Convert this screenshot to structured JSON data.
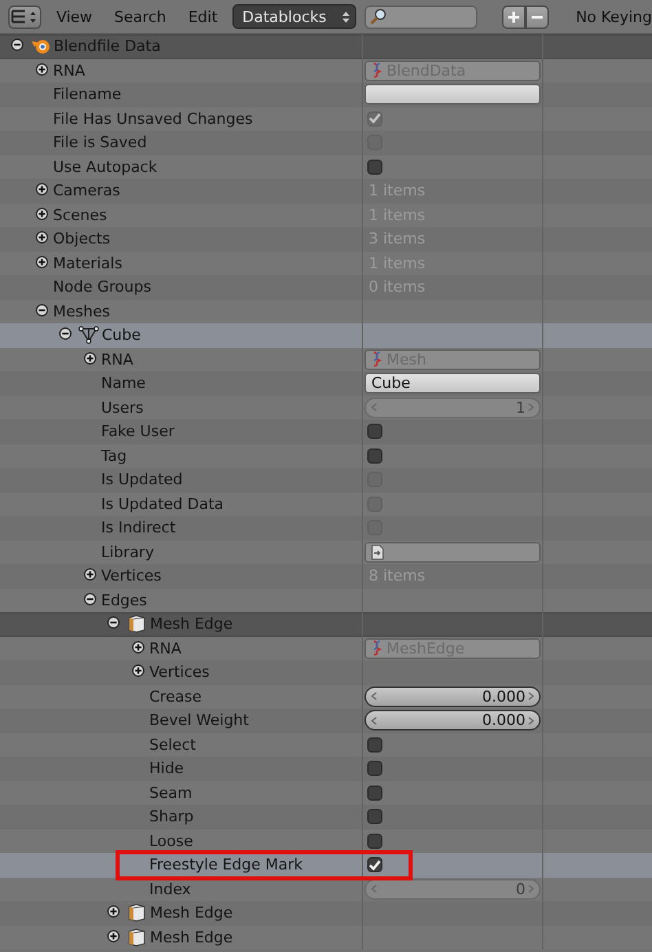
{
  "header": {
    "menus": [
      "View",
      "Search",
      "Edit"
    ],
    "display_mode": "Datablocks",
    "keying": "No Keying"
  },
  "tree": [
    {
      "label": "Blendfile Data",
      "kind": "blend",
      "expanded": true,
      "selected": false,
      "active": true,
      "children": [
        {
          "label": "RNA",
          "expanded": false,
          "selected": false,
          "active": false,
          "value": {
            "kind": "rna",
            "text": "BlendData"
          }
        },
        {
          "label": "Filename",
          "selected": false,
          "active": false,
          "value": {
            "kind": "field"
          }
        },
        {
          "label": "File Has Unsaved Changes",
          "selected": false,
          "active": false,
          "value": {
            "kind": "checkbox",
            "checked": true,
            "disabled": true
          }
        },
        {
          "label": "File is Saved",
          "selected": false,
          "active": false,
          "value": {
            "kind": "checkbox",
            "checked": false,
            "disabled": true
          }
        },
        {
          "label": "Use Autopack",
          "selected": false,
          "active": false,
          "value": {
            "kind": "checkbox",
            "checked": false,
            "disabled": false
          }
        },
        {
          "label": "Cameras",
          "expanded": false,
          "selected": false,
          "active": false,
          "value": {
            "kind": "count",
            "text": "1 items"
          }
        },
        {
          "label": "Scenes",
          "expanded": false,
          "selected": false,
          "active": false,
          "value": {
            "kind": "count",
            "text": "1 items"
          }
        },
        {
          "label": "Objects",
          "expanded": false,
          "selected": false,
          "active": false,
          "value": {
            "kind": "count",
            "text": "3 items"
          }
        },
        {
          "label": "Materials",
          "expanded": false,
          "selected": false,
          "active": false,
          "value": {
            "kind": "count",
            "text": "1 items"
          }
        },
        {
          "label": "Node Groups",
          "selected": false,
          "active": false,
          "value": {
            "kind": "count",
            "text": "0 items"
          }
        },
        {
          "label": "Meshes",
          "expanded": true,
          "selected": false,
          "active": false,
          "children": [
            {
              "label": "Cube",
              "kind": "mesh",
              "expanded": true,
              "selected": true,
              "active": false,
              "children": [
                {
                  "label": "RNA",
                  "expanded": false,
                  "selected": false,
                  "active": false,
                  "value": {
                    "kind": "rna",
                    "text": "Mesh"
                  }
                },
                {
                  "label": "Name",
                  "selected": false,
                  "active": false,
                  "value": {
                    "kind": "field",
                    "text": "Cube"
                  }
                },
                {
                  "label": "Users",
                  "selected": false,
                  "active": false,
                  "value": {
                    "kind": "number",
                    "text": "1",
                    "disabled": true
                  }
                },
                {
                  "label": "Fake User",
                  "selected": false,
                  "active": false,
                  "value": {
                    "kind": "checkbox",
                    "checked": false,
                    "disabled": false
                  }
                },
                {
                  "label": "Tag",
                  "selected": false,
                  "active": false,
                  "value": {
                    "kind": "checkbox",
                    "checked": false,
                    "disabled": false
                  }
                },
                {
                  "label": "Is Updated",
                  "selected": false,
                  "active": false,
                  "value": {
                    "kind": "checkbox",
                    "checked": false,
                    "disabled": true
                  }
                },
                {
                  "label": "Is Updated Data",
                  "selected": false,
                  "active": false,
                  "value": {
                    "kind": "checkbox",
                    "checked": false,
                    "disabled": true
                  }
                },
                {
                  "label": "Is Indirect",
                  "selected": false,
                  "active": false,
                  "value": {
                    "kind": "checkbox",
                    "checked": false,
                    "disabled": true
                  }
                },
                {
                  "label": "Library",
                  "selected": false,
                  "active": false,
                  "value": {
                    "kind": "library"
                  }
                },
                {
                  "label": "Vertices",
                  "expanded": false,
                  "selected": false,
                  "active": false,
                  "value": {
                    "kind": "count",
                    "text": "8 items"
                  }
                },
                {
                  "label": "Edges",
                  "expanded": true,
                  "selected": false,
                  "active": false,
                  "children": [
                    {
                      "label": "Mesh Edge",
                      "kind": "edge",
                      "expanded": true,
                      "selected": false,
                      "active": true,
                      "children": [
                        {
                          "label": "RNA",
                          "expanded": false,
                          "selected": false,
                          "active": false,
                          "value": {
                            "kind": "rna",
                            "text": "MeshEdge"
                          }
                        },
                        {
                          "label": "Vertices",
                          "expanded": false,
                          "selected": false,
                          "active": false
                        },
                        {
                          "label": "Crease",
                          "selected": false,
                          "active": false,
                          "value": {
                            "kind": "number",
                            "text": "0.000",
                            "disabled": false
                          }
                        },
                        {
                          "label": "Bevel Weight",
                          "selected": false,
                          "active": false,
                          "value": {
                            "kind": "number",
                            "text": "0.000",
                            "disabled": false
                          }
                        },
                        {
                          "label": "Select",
                          "selected": false,
                          "active": false,
                          "value": {
                            "kind": "checkbox",
                            "checked": false,
                            "disabled": false
                          }
                        },
                        {
                          "label": "Hide",
                          "selected": false,
                          "active": false,
                          "value": {
                            "kind": "checkbox",
                            "checked": false,
                            "disabled": false
                          }
                        },
                        {
                          "label": "Seam",
                          "selected": false,
                          "active": false,
                          "value": {
                            "kind": "checkbox",
                            "checked": false,
                            "disabled": false
                          }
                        },
                        {
                          "label": "Sharp",
                          "selected": false,
                          "active": false,
                          "value": {
                            "kind": "checkbox",
                            "checked": false,
                            "disabled": false
                          }
                        },
                        {
                          "label": "Loose",
                          "selected": false,
                          "active": false,
                          "value": {
                            "kind": "checkbox",
                            "checked": false,
                            "disabled": false
                          }
                        },
                        {
                          "label": "Freestyle Edge Mark",
                          "selected": true,
                          "active": false,
                          "boxed": true,
                          "value": {
                            "kind": "checkbox",
                            "checked": true,
                            "disabled": false
                          }
                        },
                        {
                          "label": "Index",
                          "selected": false,
                          "active": false,
                          "value": {
                            "kind": "number",
                            "text": "0",
                            "disabled": true
                          }
                        }
                      ]
                    },
                    {
                      "label": "Mesh Edge",
                      "kind": "edge",
                      "expanded": false,
                      "selected": false,
                      "active": false
                    },
                    {
                      "label": "Mesh Edge",
                      "kind": "edge",
                      "expanded": false,
                      "selected": false,
                      "active": false
                    }
                  ]
                }
              ]
            }
          ]
        }
      ]
    }
  ]
}
